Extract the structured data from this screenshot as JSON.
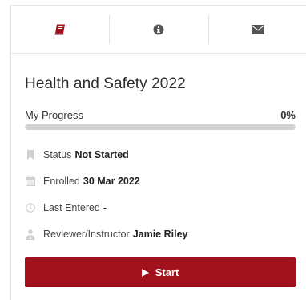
{
  "tabs": [
    {
      "icon": "book-icon",
      "active": true
    },
    {
      "icon": "info-circle-icon",
      "active": false
    },
    {
      "icon": "envelope-icon",
      "active": false
    }
  ],
  "course": {
    "title": "Health and Safety 2022"
  },
  "progress": {
    "label": "My Progress",
    "percent_text": "0%",
    "value": 0
  },
  "details": {
    "status": {
      "icon": "bookmark-icon",
      "label": "Status",
      "value": "Not Started"
    },
    "enrolled": {
      "icon": "calendar-icon",
      "label": "Enrolled",
      "value": "30 Mar 2022"
    },
    "last_entered": {
      "icon": "clock-icon",
      "label": "Last Entered",
      "value": "-"
    },
    "reviewer": {
      "icon": "user-tie-icon",
      "label": "Reviewer/Instructor",
      "value": "Jamie Riley"
    }
  },
  "actions": {
    "start_label": "Start"
  },
  "colors": {
    "brand": "#a1101d",
    "muted_icon": "#cfcfcf",
    "tab_icon": "#555555"
  }
}
